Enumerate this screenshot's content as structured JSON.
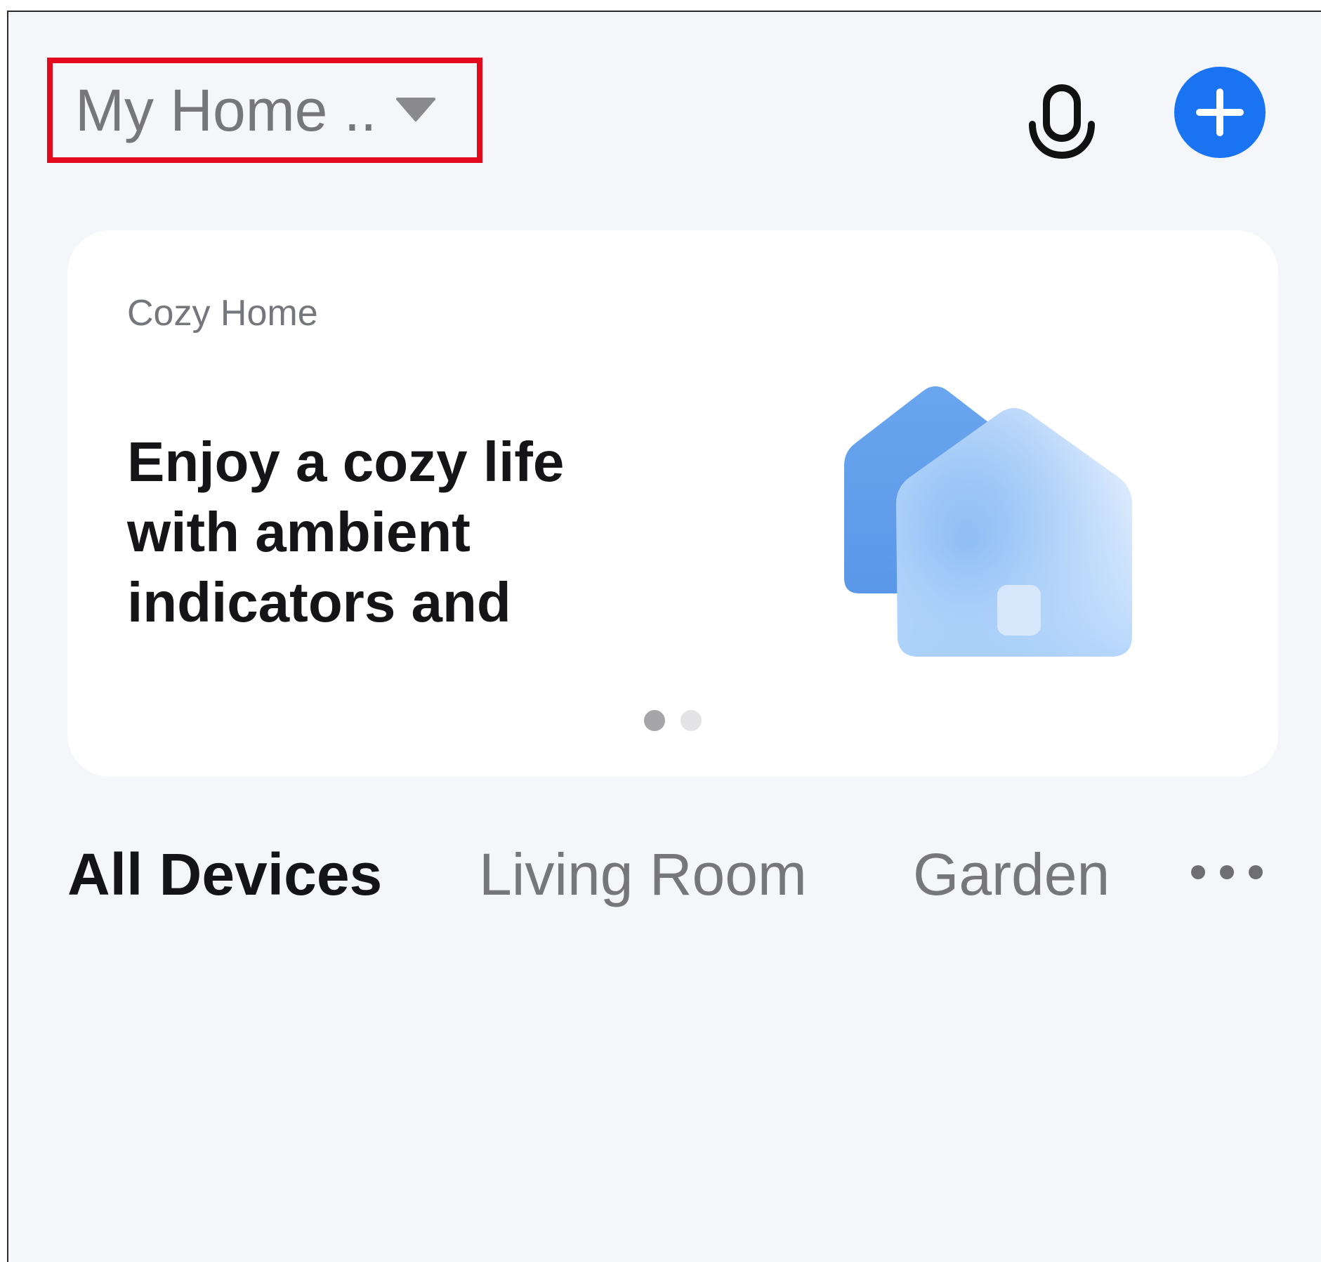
{
  "header": {
    "home_name": "My Home ..",
    "caret_icon": "caret-down-icon",
    "mic_icon": "microphone-icon",
    "add_icon": "plus-icon"
  },
  "banner": {
    "kicker": "Cozy Home",
    "headline": "Enjoy a cozy life with ambient indicators and",
    "illustration_icon": "houses-illustration",
    "pager": {
      "total": 2,
      "active_index": 0
    }
  },
  "room_tabs": {
    "items": [
      {
        "label": "All Devices",
        "active": true
      },
      {
        "label": "Living Room",
        "active": false
      },
      {
        "label": "Garden",
        "active": false
      }
    ],
    "more_icon": "more-dots-icon"
  },
  "colors": {
    "background": "#f4f6fa",
    "card": "#ffffff",
    "accent_blue": "#1a73f0",
    "highlight_red": "#e20a1c",
    "muted_text": "#77777a",
    "primary_text": "#141416",
    "pager_active": "#a6a6a8",
    "pager_inactive": "#e3e3e5"
  }
}
